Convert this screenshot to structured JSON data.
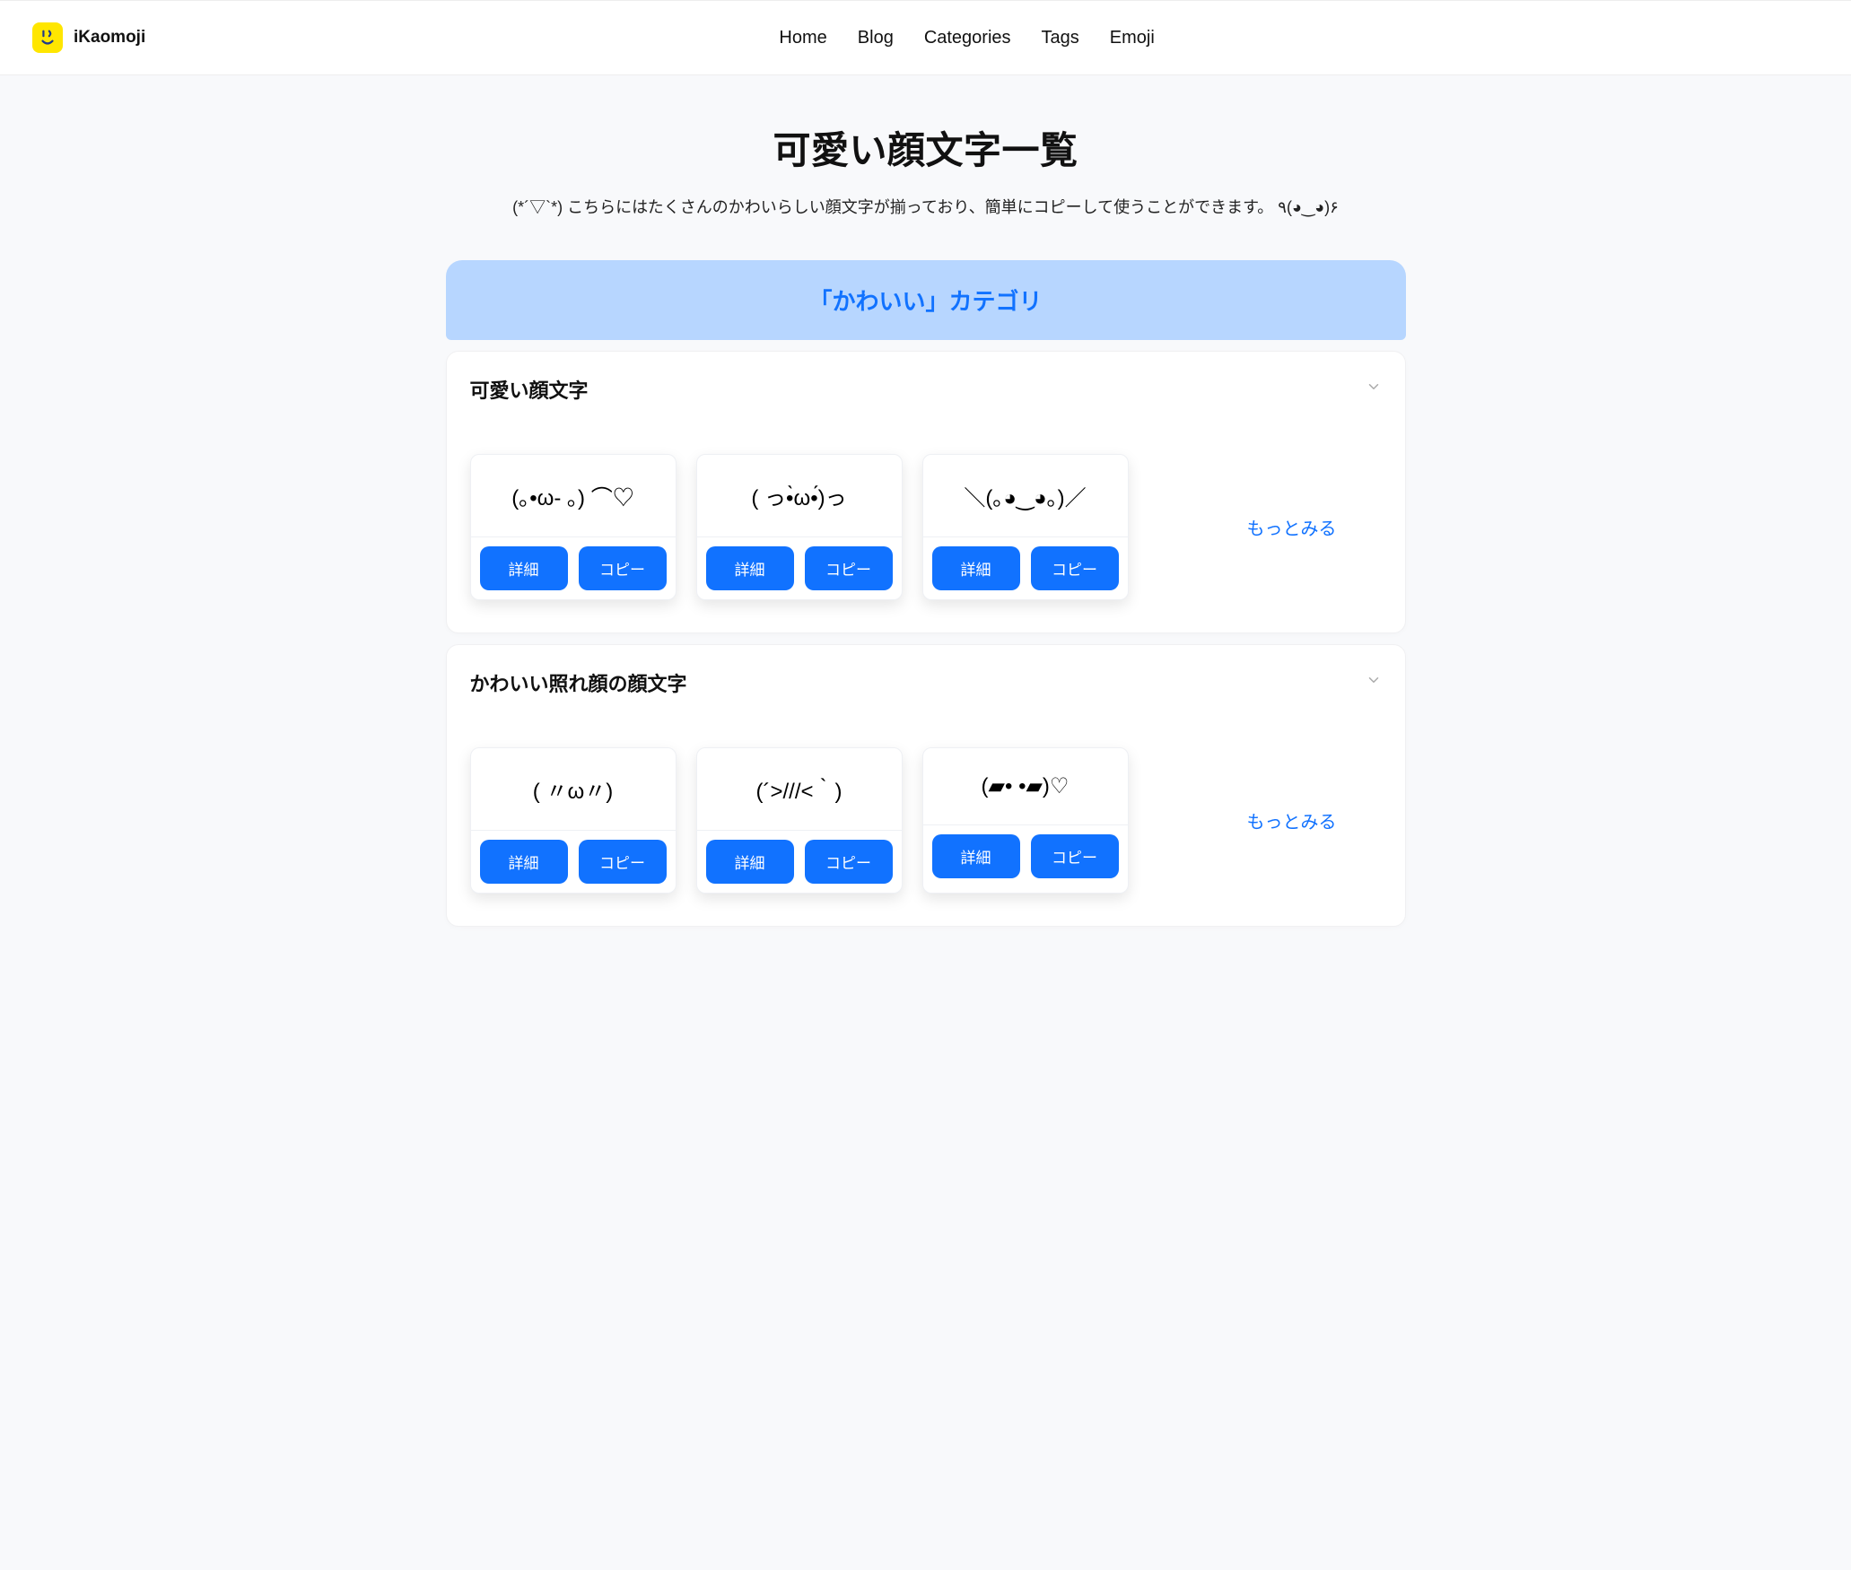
{
  "brand": {
    "name": "iKaomoji"
  },
  "nav": {
    "home": "Home",
    "blog": "Blog",
    "categories": "Categories",
    "tags": "Tags",
    "emoji": "Emoji"
  },
  "hero": {
    "title": "可愛い顔文字一覧",
    "subtitle": "(*´▽`*) こちらにはたくさんのかわいらしい顔文字が揃っており、簡単にコピーして使うことができます。 ٩(◕‿◕)۶"
  },
  "category_banner": "「かわいい」カテゴリ",
  "labels": {
    "detail": "詳細",
    "copy": "コピー",
    "more": "もっとみる"
  },
  "sections": [
    {
      "title": "可愛い顔文字",
      "cards": [
        {
          "face": "(｡•ω- ｡) ⌒♡"
        },
        {
          "face": "( っ•̀ω•́)っ"
        },
        {
          "face": "＼(｡◕‿◕｡)／"
        }
      ]
    },
    {
      "title": "かわいい照れ顔の顔文字",
      "cards": [
        {
          "face": "( 〃ω〃)"
        },
        {
          "face": "(´>///<｀)"
        },
        {
          "face": "(▰•  •▰)♡"
        }
      ]
    }
  ]
}
